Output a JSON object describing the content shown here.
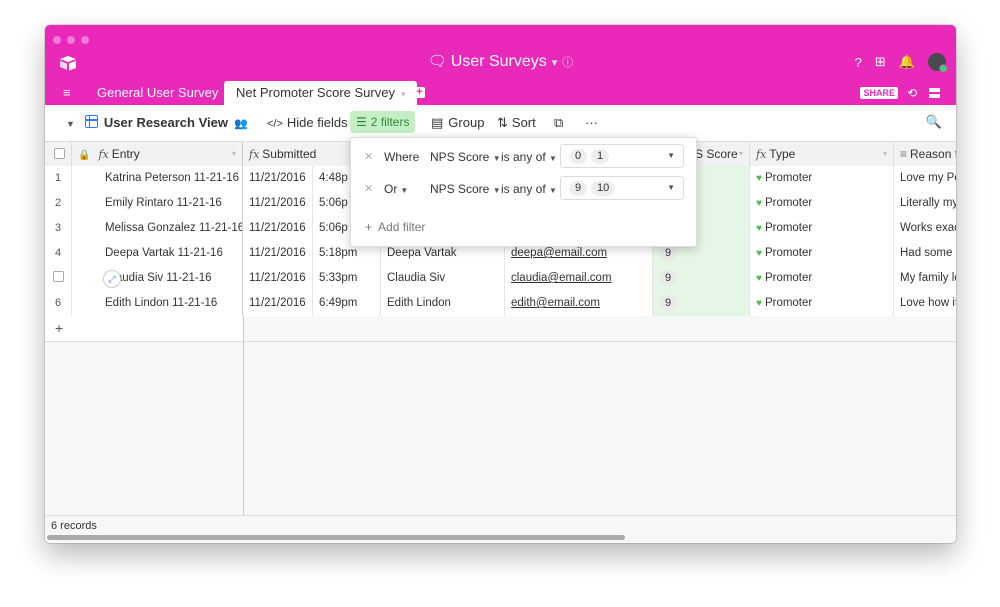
{
  "window": {
    "title": "User Surveys"
  },
  "tabs": [
    {
      "label": "General User Survey"
    },
    {
      "label": "Net Promoter Score Survey"
    }
  ],
  "header": {
    "share_label": "SHARE"
  },
  "toolbar": {
    "view_name": "User Research View",
    "hide_fields": "Hide fields",
    "filters": "2 filters",
    "group": "Group",
    "sort": "Sort",
    "more": "···"
  },
  "columns": {
    "entry": "Entry",
    "submitted": "Submitted",
    "nps_partial": "S Score",
    "type": "Type",
    "reason_partial": "Reason f"
  },
  "rows": [
    {
      "n": "1",
      "entry": "Katrina Peterson 11-21-16",
      "date": "11/21/2016",
      "time": "4:48p",
      "name": "",
      "email": "",
      "nps": "",
      "type": "Promoter",
      "reason": "Love my Po"
    },
    {
      "n": "2",
      "entry": "Emily Rintaro 11-21-16",
      "date": "11/21/2016",
      "time": "5:06p",
      "name": "",
      "email": "",
      "nps": "",
      "type": "Promoter",
      "reason": "Literally my"
    },
    {
      "n": "3",
      "entry": "Melissa Gonzalez 11-21-16",
      "date": "11/21/2016",
      "time": "5:06p",
      "name": "",
      "email": "",
      "nps": "",
      "type": "Promoter",
      "reason": "Works exac"
    },
    {
      "n": "4",
      "entry": "Deepa Vartak 11-21-16",
      "date": "11/21/2016",
      "time": "5:18pm",
      "name": "Deepa Vartak",
      "email": "deepa@email.com",
      "nps": "9",
      "type": "Promoter",
      "reason": "Had some i"
    },
    {
      "n": "",
      "entry": "Claudia Siv 11-21-16",
      "date": "11/21/2016",
      "time": "5:33pm",
      "name": "Claudia Siv",
      "email": "claudia@email.com",
      "nps": "9",
      "type": "Promoter",
      "reason": "My family lo"
    },
    {
      "n": "6",
      "entry": "Edith Lindon 11-21-16",
      "date": "11/21/2016",
      "time": "6:49pm",
      "name": "Edith Lindon",
      "email": "edith@email.com",
      "nps": "9",
      "type": "Promoter",
      "reason": "Love how it"
    }
  ],
  "filter_popup": {
    "filters": [
      {
        "conjunction": "Where",
        "field": "NPS Score",
        "operator": "is any of",
        "values": [
          "0",
          "1"
        ]
      },
      {
        "conjunction": "Or",
        "field": "NPS Score",
        "operator": "is any of",
        "values": [
          "9",
          "10"
        ]
      }
    ],
    "add_filter": "Add filter"
  },
  "footer": {
    "records": "6 records"
  },
  "colors": {
    "brand": "#e829b9",
    "filter_active_bg": "#c6eec6",
    "nps_column_bg": "#e6f6e6"
  }
}
